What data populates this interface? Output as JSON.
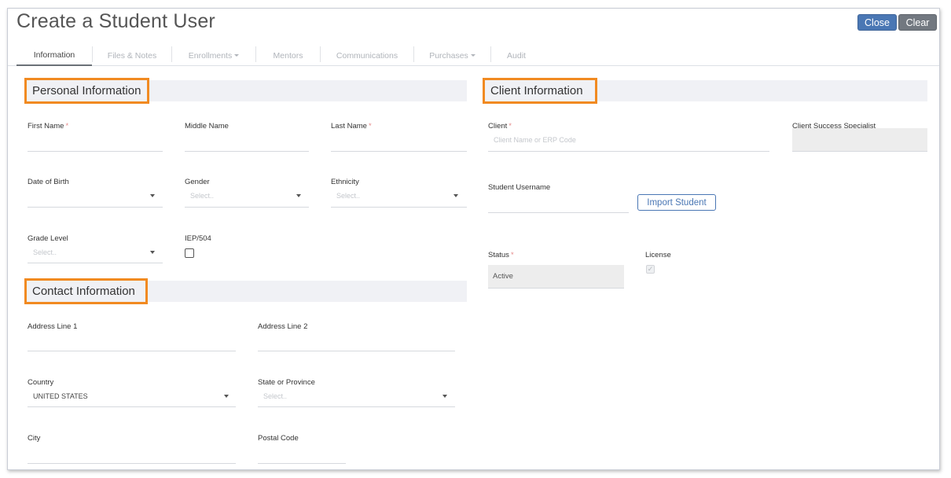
{
  "header": {
    "title": "Create a Student User",
    "close_label": "Close",
    "clear_label": "Clear"
  },
  "tabs": [
    {
      "label": "Information",
      "active": true,
      "dropdown": false
    },
    {
      "label": "Files & Notes",
      "active": false,
      "dropdown": false
    },
    {
      "label": "Enrollments",
      "active": false,
      "dropdown": true
    },
    {
      "label": "Mentors",
      "active": false,
      "dropdown": false
    },
    {
      "label": "Communications",
      "active": false,
      "dropdown": false
    },
    {
      "label": "Purchases",
      "active": false,
      "dropdown": true
    },
    {
      "label": "Audit",
      "active": false,
      "dropdown": false
    }
  ],
  "personal": {
    "title": "Personal Information",
    "first_name": "First Name",
    "middle_name": "Middle Name",
    "last_name": "Last Name",
    "date_of_birth": "Date of Birth",
    "gender": "Gender",
    "gender_placeholder": "Select..",
    "ethnicity": "Ethnicity",
    "ethnicity_placeholder": "Select..",
    "grade_level": "Grade Level",
    "grade_level_placeholder": "Select..",
    "iep": "IEP/504"
  },
  "contact": {
    "title": "Contact Information",
    "address1": "Address Line 1",
    "address2": "Address Line 2",
    "country": "Country",
    "country_value": "UNITED STATES",
    "state": "State or Province",
    "state_placeholder": "Select..",
    "city": "City",
    "postal": "Postal Code"
  },
  "client": {
    "title": "Client Information",
    "client_label": "Client",
    "client_placeholder": "Client Name or ERP Code",
    "css_label": "Client Success Specialist",
    "username_label": "Student Username",
    "import_label": "Import Student",
    "status_label": "Status",
    "status_value": "Active",
    "license_label": "License"
  },
  "required_marker": "*",
  "colors": {
    "accent_orange": "#f18a21",
    "primary_blue": "#4a77b4",
    "secondary_gray": "#727880",
    "section_bg": "#f0f1f5"
  },
  "icons": {
    "dropdown": "caret-down-icon",
    "checkmark": "check-icon"
  }
}
